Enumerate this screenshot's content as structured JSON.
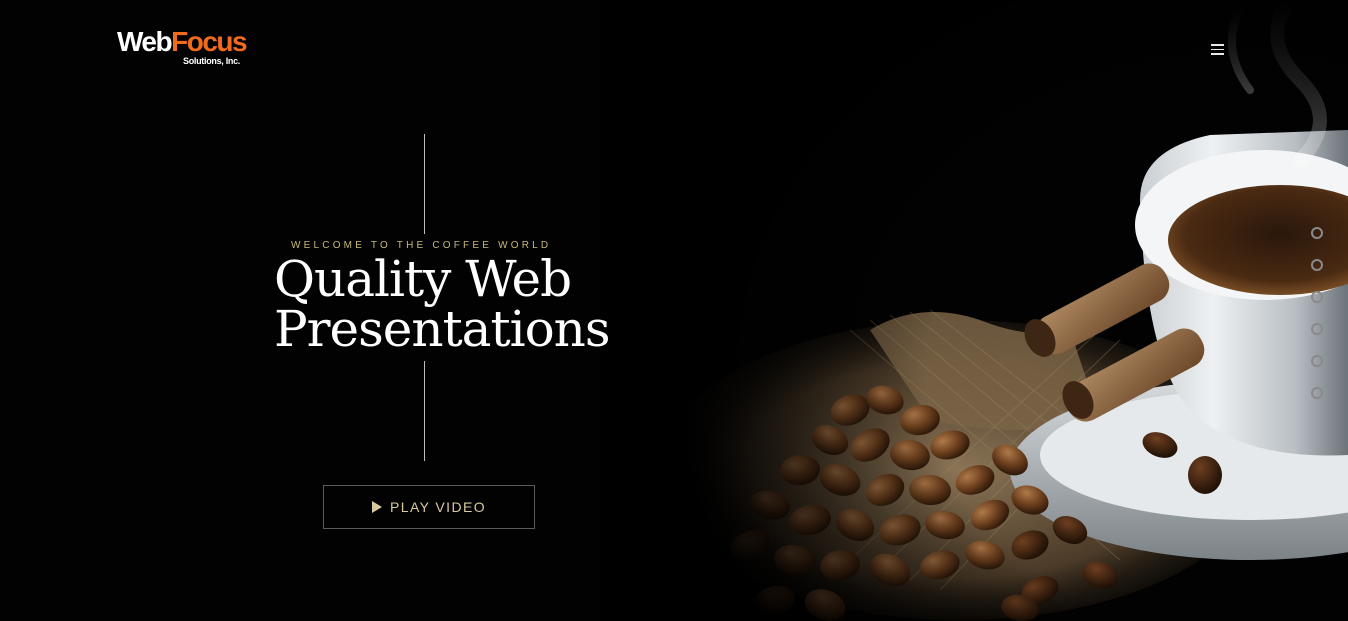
{
  "header": {
    "logo_main_web": "Web",
    "logo_main_focus": "Focus",
    "logo_sub": "Solutions, Inc.",
    "menu_icon": "hamburger-menu-icon"
  },
  "hero": {
    "eyebrow": "WELCOME TO THE COFFEE WORLD",
    "headline_line1": "Quality Web",
    "headline_line2": "Presentations",
    "play_button_label": "PLAY VIDEO",
    "play_icon": "play-icon"
  },
  "slider": {
    "dot_count": 6
  },
  "colors": {
    "background": "#000000",
    "accent_orange": "#f26a1b",
    "eyebrow_gold": "#c8b97a",
    "button_text": "#d9c9a0"
  }
}
